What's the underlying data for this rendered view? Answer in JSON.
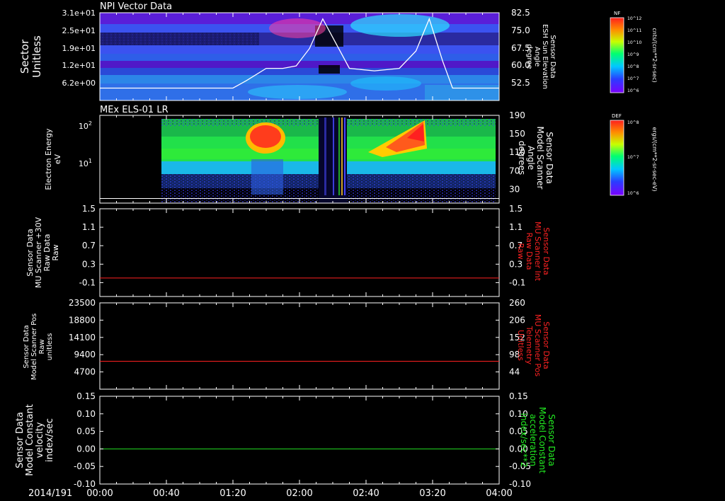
{
  "footer": {
    "date_label": "2014/191",
    "x_ticks": [
      "00:00",
      "00:40",
      "01:20",
      "02:00",
      "02:40",
      "03:20",
      "04:00"
    ]
  },
  "colors": {
    "axis": "#ffffff",
    "red_line": "#ff2020",
    "green_line": "#22dd22",
    "right_label_red": "#ff2222",
    "right_label_green": "#22ee22"
  },
  "chart_data": [
    {
      "type": "heatmap",
      "title": "NPI Vector Data",
      "ylabel": [
        "Sector",
        "Unitless"
      ],
      "y_ticks": [
        "3.1e+01",
        "2.5e+01",
        "1.9e+01",
        "1.2e+01",
        "6.2e+00"
      ],
      "right_ylabel": [
        "Sensor Data",
        "ESH Sun Elevation",
        "Angle",
        "degree"
      ],
      "right_ticks": [
        "82.5",
        "75.0",
        "67.5",
        "60.0",
        "52.5"
      ],
      "right_ylim": [
        47,
        82.5
      ],
      "colorbar": {
        "label": "NF",
        "unit": "cnts/(cm**2-sr-sec)",
        "ticks": [
          "10^12",
          "10^11",
          "10^10",
          "10^9",
          "10^8",
          "10^7",
          "10^6"
        ]
      },
      "overlay_line": {
        "x_minutes": [
          0,
          60,
          80,
          88,
          100,
          110,
          118,
          126,
          134,
          142,
          150,
          165,
          180,
          190,
          198,
          206,
          212,
          240
        ],
        "values": [
          52,
          52,
          52,
          55,
          60,
          60,
          61,
          68,
          80,
          70,
          60,
          59,
          60,
          67,
          80,
          63,
          52,
          52
        ]
      }
    },
    {
      "type": "heatmap",
      "title": "MEx ELS-01 LR",
      "ylabel": [
        "Electron Energy",
        "eV"
      ],
      "y_ticks": [
        "10^2",
        "10^1"
      ],
      "right_ylabel": [
        "Sensor Data",
        "Model Scanner",
        "Angle",
        "degrees"
      ],
      "right_ticks": [
        "190",
        "150",
        "110",
        "70",
        "30"
      ],
      "right_ylim": [
        0,
        190
      ],
      "colorbar": {
        "label": "DEF",
        "unit": "ergs/(cm**2-sr-sec-eV)",
        "ticks": [
          "10^8",
          "10^7",
          "10^6"
        ]
      },
      "overlay_line": {
        "x_minutes": [
          0,
          240
        ],
        "values": [
          10,
          10
        ]
      }
    },
    {
      "type": "line",
      "ylabel": [
        "Sensor Data",
        "MU Scanner +30V",
        "Raw Data",
        "Raw"
      ],
      "y_ticks": [
        "1.5",
        "1.1",
        "0.7",
        "0.3",
        "-0.1"
      ],
      "ylim": [
        -0.4,
        1.5
      ],
      "right_ylabel": [
        "Sensor Data",
        "MU Scanner Int",
        "Raw Data",
        "Raw"
      ],
      "right_ticks": [
        "1.5",
        "1.1",
        "0.7",
        "0.3",
        "-0.1"
      ],
      "series": [
        {
          "x_minutes": [
            0,
            240
          ],
          "values": [
            0.0,
            0.0
          ]
        }
      ]
    },
    {
      "type": "line",
      "ylabel": [
        "Sensor Data",
        "Model Scanner Pos",
        "Raw",
        "unitless"
      ],
      "y_ticks": [
        "23500",
        "18800",
        "14100",
        "9400",
        "4700"
      ],
      "ylim": [
        0,
        23500
      ],
      "right_ylabel": [
        "Sensor Data",
        "MU Scanner Pos",
        "Telemetry",
        "Unitless"
      ],
      "right_ticks": [
        "260",
        "206",
        "152",
        "98",
        "44"
      ],
      "series": [
        {
          "x_minutes": [
            0,
            240
          ],
          "values": [
            7600,
            7600
          ]
        }
      ]
    },
    {
      "type": "line",
      "ylabel": [
        "Sensor Data",
        "Model Constant",
        "velocity",
        "index/sec"
      ],
      "y_ticks": [
        "0.15",
        "0.10",
        "0.05",
        "0.00",
        "-0.05",
        "-0.10"
      ],
      "ylim": [
        -0.1,
        0.15
      ],
      "right_ylabel": [
        "Sensor Data",
        "Model Constant",
        "acceleration",
        "index/sec**2"
      ],
      "right_ticks": [
        "0.15",
        "0.10",
        "0.05",
        "0.00",
        "-0.05",
        "-0.10"
      ],
      "series": [
        {
          "x_minutes": [
            0,
            240
          ],
          "values": [
            0.0,
            0.0
          ]
        }
      ]
    }
  ]
}
